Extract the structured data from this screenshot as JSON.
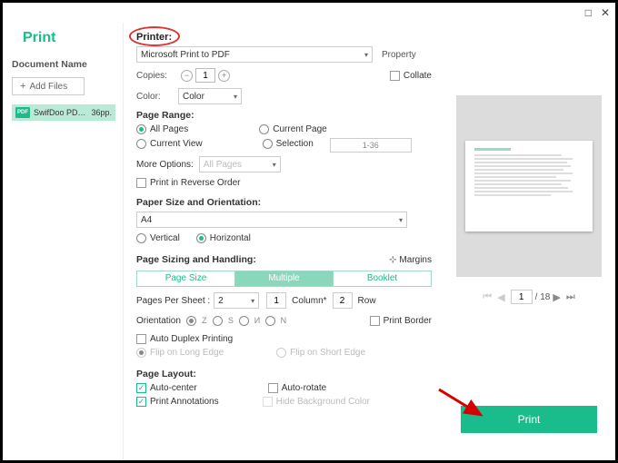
{
  "window": {
    "title": "Print",
    "maximize_icon": "□",
    "close_icon": "✕"
  },
  "left": {
    "doc_name_label": "Document Name",
    "add_files": "Add Files",
    "file": {
      "name": "SwifDoo PDF ...",
      "pages": "36pp."
    }
  },
  "printer": {
    "label": "Printer:",
    "selected": "Microsoft Print to PDF",
    "property": "Property"
  },
  "copies": {
    "label": "Copies:",
    "value": "1",
    "collate": "Collate"
  },
  "color": {
    "label": "Color:",
    "selected": "Color"
  },
  "page_range": {
    "label": "Page Range:",
    "all_pages": "All Pages",
    "current_page": "Current Page",
    "current_view": "Current View",
    "selection": "Selection",
    "range_value": "1-36"
  },
  "more_options": {
    "label": "More Options:",
    "value": "All Pages",
    "reverse": "Print in Reverse Order"
  },
  "paper": {
    "label": "Paper Size and Orientation:",
    "size": "A4",
    "vertical": "Vertical",
    "horizontal": "Horizontal"
  },
  "sizing": {
    "label": "Page Sizing and Handling:",
    "margins": "Margins",
    "tabs": {
      "page_size": "Page Size",
      "multiple": "Multiple",
      "booklet": "Booklet"
    },
    "pps_label": "Pages Per Sheet :",
    "pps_value": "2",
    "column_value": "1",
    "column_label": "Column*",
    "row_value": "2",
    "row_label": "Row",
    "orientation_label": "Orientation",
    "print_border": "Print Border"
  },
  "duplex": {
    "auto": "Auto Duplex Printing",
    "long_edge": "Flip on Long Edge",
    "short_edge": "Flip on Short Edge"
  },
  "layout": {
    "label": "Page Layout:",
    "auto_center": "Auto-center",
    "auto_rotate": "Auto-rotate",
    "print_annotations": "Print Annotations",
    "hide_bg": "Hide Background Color"
  },
  "preview": {
    "page": "1",
    "total": "/ 18"
  },
  "actions": {
    "print": "Print"
  }
}
